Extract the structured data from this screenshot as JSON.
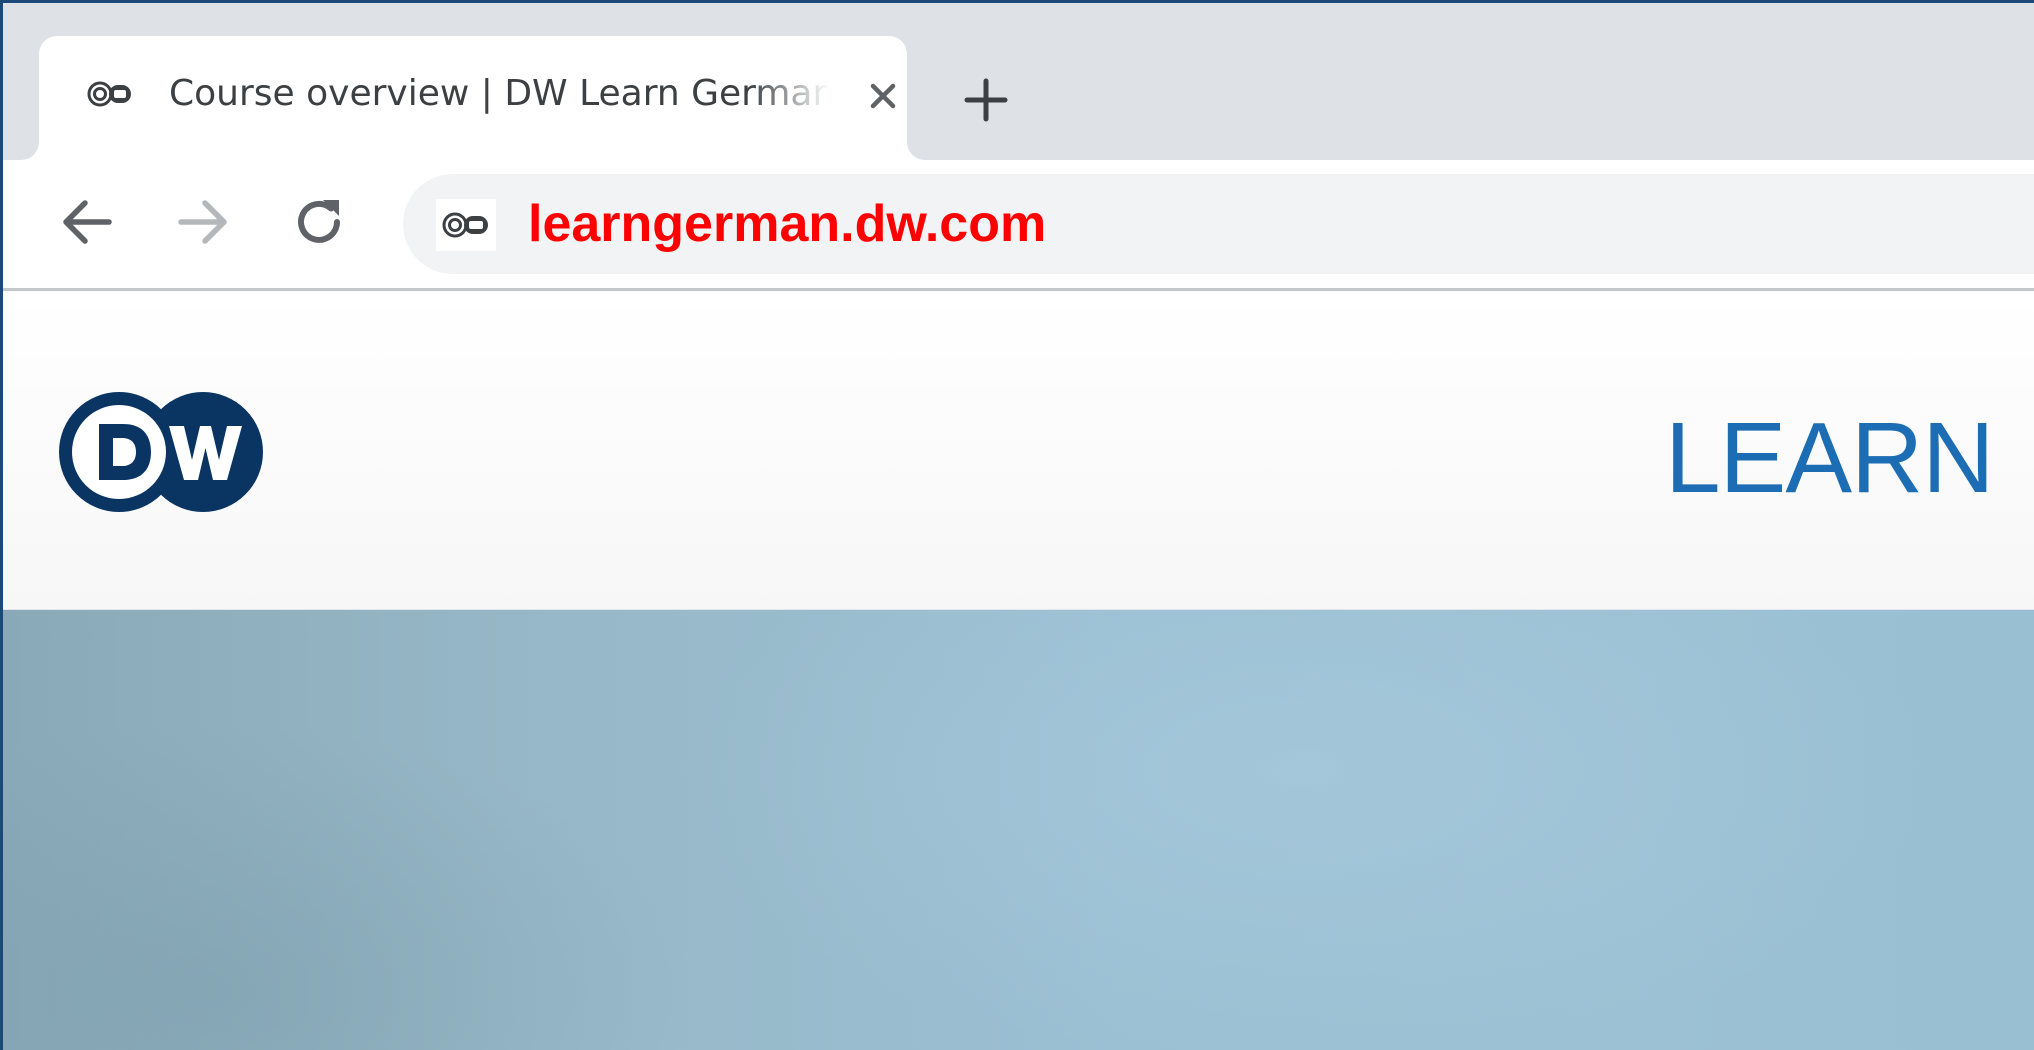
{
  "browser": {
    "tabs": [
      {
        "title": "Course overview | DW Learn German",
        "favicon": "dw-favicon-icon",
        "active": true
      }
    ],
    "new_tab_icon": "plus-icon",
    "close_tab_icon": "close-icon",
    "nav": {
      "back_icon": "arrow-left-icon",
      "forward_icon": "arrow-right-icon",
      "reload_icon": "reload-icon",
      "forward_enabled": false
    },
    "address_bar": {
      "url": "learngerman.dw.com",
      "url_color": "#ff0000",
      "site_icon": "dw-favicon-icon"
    }
  },
  "page": {
    "logo_text": "DW",
    "logo_color": "#0a3563",
    "heading": "LEARN",
    "heading_color": "#1c6db3",
    "hero_color": "#9bbfd2"
  }
}
